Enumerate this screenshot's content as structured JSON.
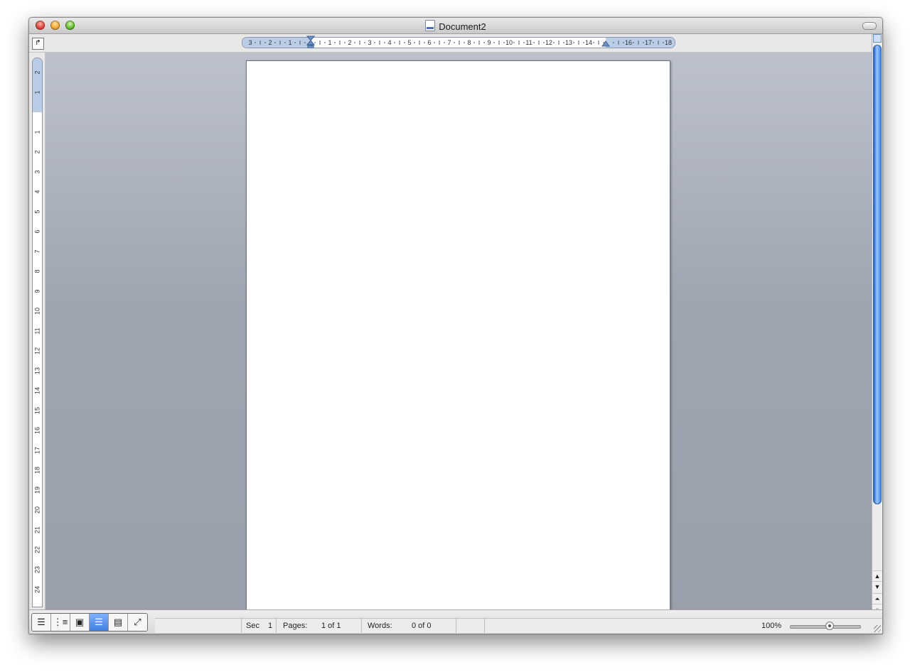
{
  "window": {
    "title": "Document2"
  },
  "rulers": {
    "horizontal_labels": [
      "3",
      "2",
      "1",
      "1",
      "2",
      "3",
      "4",
      "5",
      "6",
      "7",
      "8",
      "9",
      "10",
      "11",
      "12",
      "13",
      "14",
      "16",
      "17",
      "18"
    ],
    "vertical_labels": [
      "2",
      "1",
      "1",
      "2",
      "3",
      "4",
      "5",
      "6",
      "7",
      "8",
      "9",
      "10",
      "11",
      "12",
      "13",
      "14",
      "15",
      "16",
      "17",
      "18",
      "19",
      "20",
      "21",
      "22",
      "23",
      "24"
    ]
  },
  "icons": {
    "doc": "document-icon",
    "corner": "tab-stop-icon",
    "views": [
      "draft-view-icon",
      "outline-view-icon",
      "publishing-layout-view-icon",
      "print-layout-view-icon",
      "notebook-layout-view-icon",
      "full-screen-view-icon"
    ]
  },
  "status": {
    "sec_label": "Sec",
    "sec_value": "1",
    "pages_label": "Pages:",
    "pages_value": "1 of 1",
    "words_label": "Words:",
    "words_value": "0 of 0",
    "zoom": "100%"
  },
  "scroll": {
    "up": "▲",
    "down": "▼",
    "prev_page": "⏶",
    "browse": "○",
    "next_page": "⏷"
  },
  "colors": {
    "accent": "#3f7fe0",
    "page": "#ffffff",
    "background": "#9fa5b0"
  }
}
